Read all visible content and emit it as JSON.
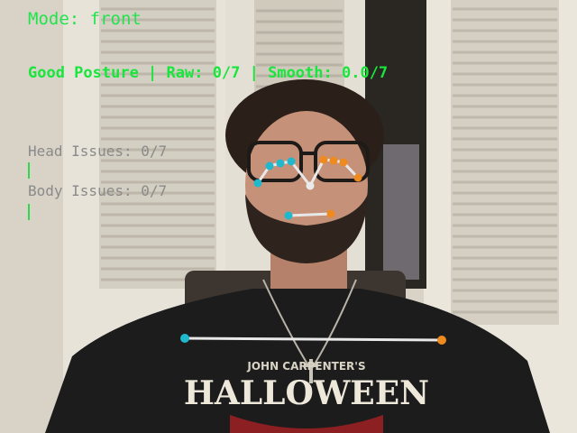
{
  "overlay": {
    "mode_label": "Mode: front",
    "posture_line": "Good Posture | Raw: 0/7 | Smooth: 0.0/7",
    "head_issues": "Head Issues: 0/7",
    "body_issues": "Body Issues: 0/7"
  },
  "shirt_print": {
    "top_line": "JOHN CARPENTER'S",
    "title": "HALLOWEEN"
  },
  "colors": {
    "hud_green": "#22e34d",
    "hud_gray": "#8a8a8a",
    "left_keypoint": "#1fb8cc",
    "right_keypoint": "#ee8a1e",
    "skeleton_line": "#e8e8e8"
  }
}
